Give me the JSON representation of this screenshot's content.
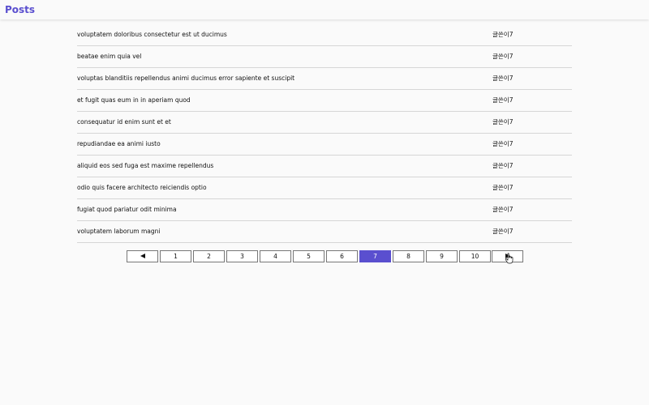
{
  "header": {
    "title": "Posts"
  },
  "posts": [
    {
      "title": "voluptatem doloribus consectetur est ut ducimus",
      "author": "글쓴이7"
    },
    {
      "title": "beatae enim quia vel",
      "author": "글쓴이7"
    },
    {
      "title": "voluptas blanditiis repellendus animi ducimus error sapiente et suscipit",
      "author": "글쓴이7"
    },
    {
      "title": "et fugit quas eum in in aperiam quod",
      "author": "글쓴이7"
    },
    {
      "title": "consequatur id enim sunt et et",
      "author": "글쓴이7"
    },
    {
      "title": "repudiandae ea animi iusto",
      "author": "글쓴이7"
    },
    {
      "title": "aliquid eos sed fuga est maxime repellendus",
      "author": "글쓴이7"
    },
    {
      "title": "odio quis facere architecto reiciendis optio",
      "author": "글쓴이7"
    },
    {
      "title": "fugiat quod pariatur odit minima",
      "author": "글쓴이7"
    },
    {
      "title": "voluptatem laborum magni",
      "author": "글쓴이7"
    }
  ],
  "pagination": {
    "prev_icon": "triangle-left-icon",
    "next_icon": "triangle-right-icon",
    "pages": [
      "1",
      "2",
      "3",
      "4",
      "5",
      "6",
      "7",
      "8",
      "9",
      "10"
    ],
    "current_page": "7"
  },
  "colors": {
    "accent": "#5a4fcf",
    "background": "#fafafa",
    "divider": "#d6d6d6"
  }
}
